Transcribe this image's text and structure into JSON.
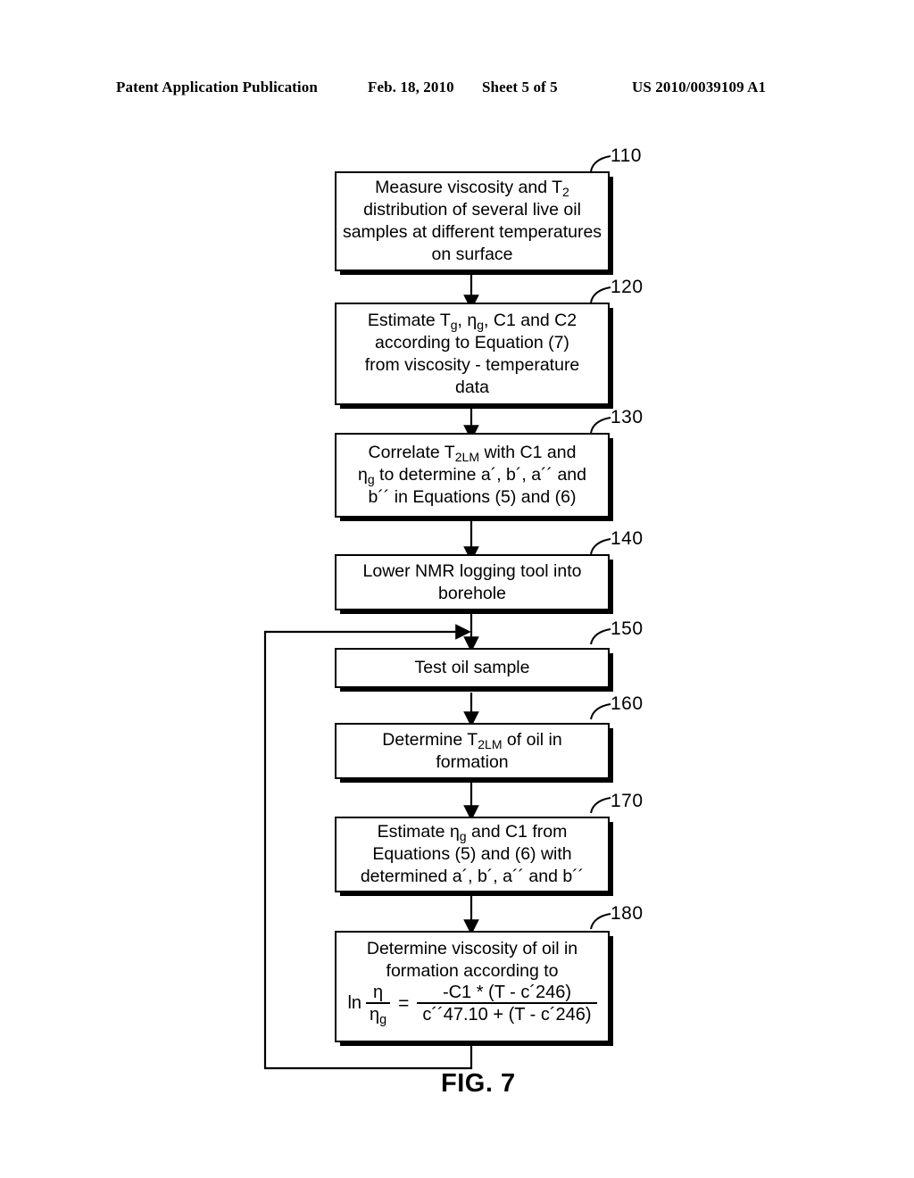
{
  "header": {
    "publication": "Patent Application Publication",
    "date": "Feb. 18, 2010",
    "sheet": "Sheet 5 of 5",
    "patent_number": "US 2010/0039109 A1"
  },
  "figure": {
    "caption": "FIG. 7",
    "boxes": [
      {
        "ref": "110",
        "lines": [
          "Measure viscosity and T2",
          "distribution of several live oil",
          "samples at different temperatures",
          "on surface"
        ],
        "text": "Measure viscosity and T2 distribution of several live oil samples at different temperatures on surface"
      },
      {
        "ref": "120",
        "lines": [
          "Estimate Tg, ηg, C1 and C2",
          "according to Equation (7)",
          "from viscosity - temperature",
          "data"
        ],
        "text": "Estimate Tg, ηg, C1 and C2 according to Equation (7) from viscosity - temperature data"
      },
      {
        "ref": "130",
        "lines": [
          "Correlate T2LM with C1 and",
          "ηg to determine a´, b´, a´´ and",
          "b´´ in Equations (5) and (6)"
        ],
        "text": "Correlate T2LM with C1 and ηg to determine a´, b´, a´´ and b´´ in Equations (5) and (6)"
      },
      {
        "ref": "140",
        "lines": [
          "Lower NMR logging tool into",
          "borehole"
        ],
        "text": "Lower NMR logging tool into borehole"
      },
      {
        "ref": "150",
        "lines": [
          "Test oil sample"
        ],
        "text": "Test oil sample"
      },
      {
        "ref": "160",
        "lines": [
          "Determine T2LM of oil in",
          "formation"
        ],
        "text": "Determine T2LM of oil in formation"
      },
      {
        "ref": "170",
        "lines": [
          "Estimate ηg and C1 from",
          "Equations (5) and (6) with",
          "determined a´, b´, a´´ and b´´"
        ],
        "text": "Estimate ηg and C1 from Equations (5) and (6) with determined a´, b´, a´´ and b´´"
      },
      {
        "ref": "180",
        "lines": [
          "Determine viscosity of oil in",
          "formation according to"
        ],
        "text": "Determine viscosity of oil in formation according to"
      }
    ],
    "box110": {
      "line1_a": "Measure viscosity and T",
      "line1_sub": "2",
      "line2": "distribution of several live oil",
      "line3": "samples at different temperatures",
      "line4": "on surface"
    },
    "box120": {
      "line1_a": "Estimate T",
      "line1_sub1": "g",
      "line1_b": ", η",
      "line1_sub2": "g",
      "line1_c": ", C1 and C2",
      "line2": "according to Equation (7)",
      "line3": "from viscosity - temperature",
      "line4": "data"
    },
    "box130": {
      "line1_a": "Correlate T",
      "line1_sub": "2LM",
      "line1_b": " with C1 and",
      "line2_a": "η",
      "line2_sub": "g",
      "line2_b": " to determine a´, b´, a´´ and",
      "line3": "b´´ in Equations (5) and (6)"
    },
    "box140": {
      "line1": "Lower NMR logging tool into",
      "line2": "borehole"
    },
    "box150": {
      "line1": "Test oil sample"
    },
    "box160": {
      "line1_a": "Determine T",
      "line1_sub": "2LM",
      "line1_b": " of oil in",
      "line2": "formation"
    },
    "box170": {
      "line1_a": "Estimate η",
      "line1_sub": "g",
      "line1_b": " and C1 from",
      "line2": "Equations (5) and (6) with",
      "line3": "determined a´, b´, a´´ and  b´´"
    },
    "box180": {
      "line1": "Determine viscosity of oil in",
      "line2": "formation according to",
      "equation": {
        "ln": "ln",
        "lhs_num": "η",
        "lhs_den_a": "η",
        "lhs_den_sub": "g",
        "equals": "=",
        "rhs_num": "-C1 * (T - c´246)",
        "rhs_den": "c´´47.10 + (T - c´246)",
        "plain": "ln (η/ηg) = -C1 * (T - c´246) / (c´´47.10 + (T - c´246))"
      }
    },
    "refs": {
      "r110": "110",
      "r120": "120",
      "r130": "130",
      "r140": "140",
      "r150": "150",
      "r160": "160",
      "r170": "170",
      "r180": "180"
    }
  },
  "colors": {
    "ink": "#000000",
    "paper": "#ffffff"
  }
}
